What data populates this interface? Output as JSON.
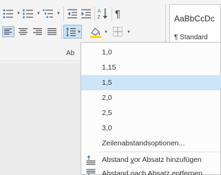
{
  "ribbon": {
    "styles_preview": "AaBbCcDc",
    "style_name": "¶ Standard",
    "group_label": "Ab"
  },
  "menu": {
    "items": [
      {
        "label": "1,0"
      },
      {
        "label": "1,15"
      },
      {
        "label": "1,5"
      },
      {
        "label": "2,0"
      },
      {
        "label": "2,5"
      },
      {
        "label": "3,0"
      }
    ],
    "options_label": "Zeilenabstandsoptionen...",
    "space_before": {
      "pre": "Abstand ",
      "accel": "v",
      "post": "or Absatz hinzufügen"
    },
    "space_after": "Abstand nach Absatz entfernen"
  },
  "colors": {
    "selected_bg": "#cde6f7",
    "accent_blue": "#2e75b6",
    "shading_yellow": "#ffd700"
  },
  "icons": [
    "bullets-icon",
    "numbering-icon",
    "multilevel-list-icon",
    "decrease-indent-icon",
    "increase-indent-icon",
    "sort-icon",
    "pilcrow-icon",
    "align-left-icon",
    "align-center-icon",
    "align-right-icon",
    "justify-icon",
    "line-spacing-icon",
    "shading-icon",
    "borders-icon",
    "add-space-before-icon",
    "remove-space-after-icon"
  ]
}
